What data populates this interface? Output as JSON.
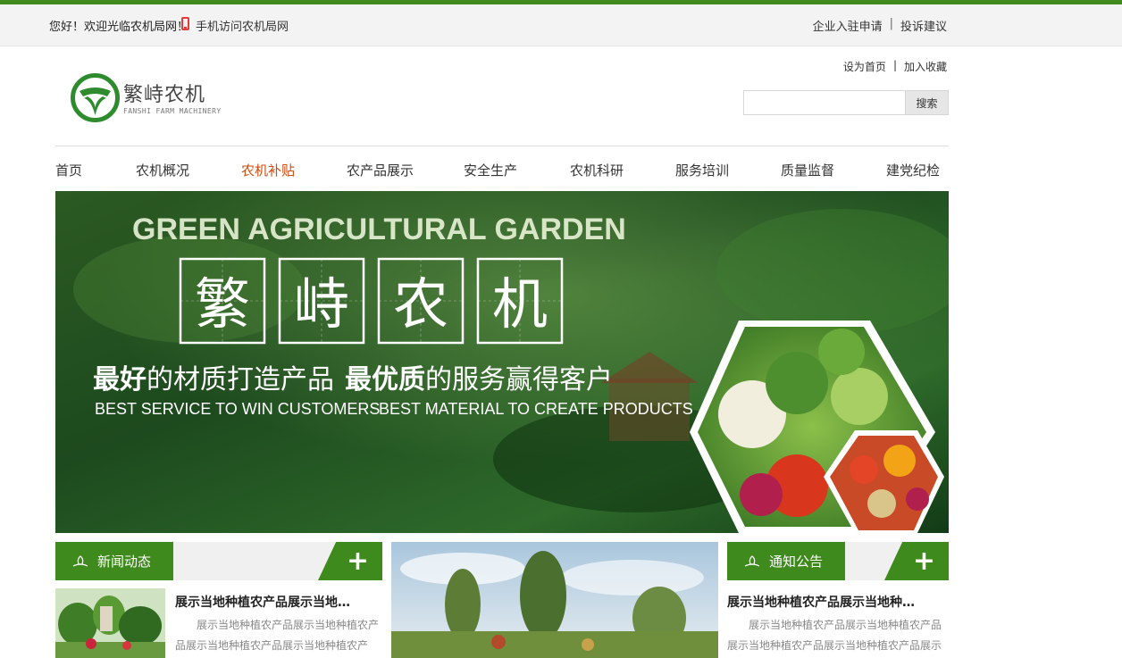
{
  "topbar": {
    "greeting": "您好！欢迎光临农机局网！",
    "mobile_link": "手机访问农机局网",
    "apply_link": "企业入驻申请",
    "separator": "|",
    "complaint_link": "投诉建议"
  },
  "header": {
    "logo_name": "繁峙农机",
    "logo_sub": "FANSHI FARM MACHINERY",
    "set_home": "设为首页",
    "separator": "|",
    "add_favorite": "加入收藏",
    "search_placeholder": "",
    "search_button": "搜索"
  },
  "nav": {
    "items": [
      {
        "label": "首页"
      },
      {
        "label": "农机概况"
      },
      {
        "label": "农机补贴"
      },
      {
        "label": "农产品展示"
      },
      {
        "label": "安全生产"
      },
      {
        "label": "农机科研"
      },
      {
        "label": "服务培训"
      },
      {
        "label": "质量监督"
      },
      {
        "label": "建党纪检"
      }
    ],
    "active_index": 2
  },
  "banner": {
    "headline_en": "GREEN AGRICULTURAL GARDEN",
    "chars": [
      "繁",
      "峙",
      "农",
      "机"
    ],
    "slogan_bold1": "最好",
    "slogan_rest1": "的材质打造产品",
    "slogan_bold2": "最优质",
    "slogan_rest2": "的服务赢得客户",
    "sub_en_1": "BEST SERVICE TO WIN CUSTOMERS",
    "sub_en_2": "BEST MATERIAL TO CREATE PRODUCTS"
  },
  "news": {
    "tab_label": "新闻动态",
    "more": "+",
    "item_title": "展示当地种植农产品展示当地…",
    "item_desc": "展示当地种植农产品展示当地种植农产品展示当地种植农产品展示当地种植农产"
  },
  "notice": {
    "tab_label": "通知公告",
    "more": "+",
    "item_title": "展示当地种植农产品展示当地种…",
    "item_desc": "展示当地种植农产品展示当地种植农产品展示当地种植农产品展示当地种植农产品展示"
  },
  "colors": {
    "brand_green": "#3f8a1c",
    "active_nav": "#cf4a0c"
  }
}
